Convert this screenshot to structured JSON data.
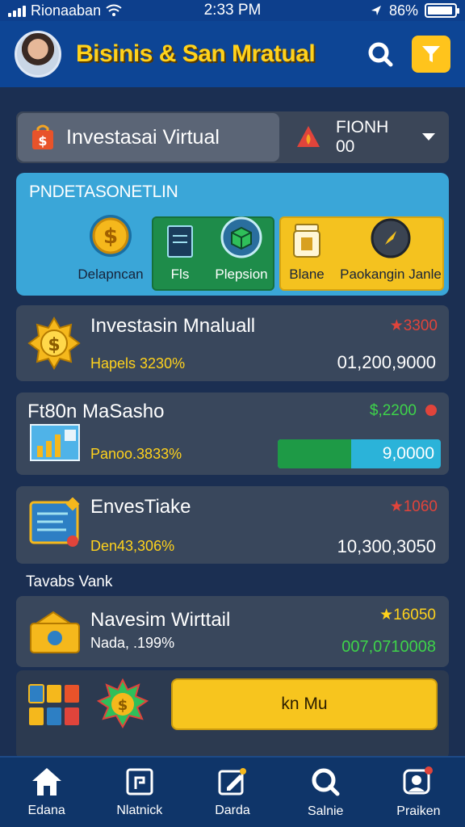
{
  "status_bar": {
    "carrier": "Rionaaban",
    "time": "2:33 PM",
    "battery": "86%"
  },
  "header": {
    "title": "Bisinis & San Mratual"
  },
  "invest_bar": {
    "label": "Investasai Virtual",
    "selected": "FIONH 00"
  },
  "categories": {
    "title": "PNDETASONETLIN",
    "items": [
      {
        "label": "Delapncan",
        "icon": "coin-icon"
      },
      {
        "label": "Fls",
        "icon": "notebook-icon"
      },
      {
        "label": "Plepsion",
        "icon": "box-icon"
      },
      {
        "label": "Blane",
        "icon": "jar-icon"
      },
      {
        "label": "Paokangin Janle",
        "icon": "compass-icon"
      }
    ]
  },
  "cards": [
    {
      "title": "Investasin Mnaluall",
      "sub": "Hapels 3230%",
      "badge": "★3300",
      "amount": "01,200,9000",
      "icon": "gear-coin-icon"
    },
    {
      "title": "Ft80n MaSasho",
      "sub": "Panoo.3833%",
      "badge": "$,2200",
      "progress_text": "9,0000",
      "progress": 0.45,
      "icon": "chart-icon"
    },
    {
      "title": "EnvesTiake",
      "sub": "Den43,306%",
      "badge": "★1060",
      "amount": "10,300,3050",
      "icon": "map-board-icon"
    }
  ],
  "section": {
    "label": "Tavabs Vank"
  },
  "virtual_card": {
    "title": "Navesim Wirttail",
    "sub": "Nada, .199%",
    "badge": "★16050",
    "amount": "007,0710008",
    "icon": "wallet-icon"
  },
  "action": {
    "button_label": "kn Mu"
  },
  "bottom_nav": [
    {
      "label": "Edana",
      "icon": "home-icon"
    },
    {
      "label": "Nlatnick",
      "icon": "document-icon"
    },
    {
      "label": "Darda",
      "icon": "edit-icon"
    },
    {
      "label": "Salnie",
      "icon": "search-icon"
    },
    {
      "label": "Praiken",
      "icon": "profile-chat-icon"
    }
  ],
  "colors": {
    "background": "#1b2f52",
    "header": "#0d4595",
    "accent_yellow": "#ffd21c",
    "positive_green": "#3ed34a",
    "negative_red": "#e0443b"
  }
}
